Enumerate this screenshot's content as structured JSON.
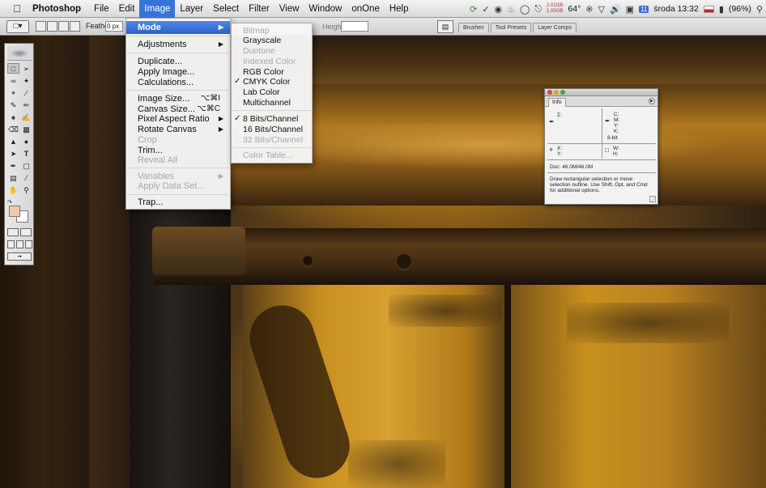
{
  "menubar": {
    "apple_icon": "apple-icon",
    "app_name": "Photoshop",
    "items": [
      "File",
      "Edit",
      "Image",
      "Layer",
      "Select",
      "Filter",
      "View",
      "Window",
      "onOne",
      "Help"
    ],
    "active_item": "Image",
    "status": {
      "memory_top": "2.01GB",
      "memory_bottom": "1.00GB",
      "temperature": "64°",
      "date_badge": "11",
      "clock": "środa 13:32",
      "battery": "(96%)"
    }
  },
  "options_bar": {
    "feather_label": "Feather:",
    "feather_value": "0 px",
    "height_label": "Height:",
    "palette_tabs": [
      "Brushes",
      "Tool Presets",
      "Layer Comps"
    ]
  },
  "image_menu": {
    "items": [
      {
        "label": "Mode",
        "highlighted": true,
        "submenu": true
      },
      {
        "label": "Adjustments",
        "submenu": true
      },
      {
        "label": "Duplicate..."
      },
      {
        "label": "Apply Image..."
      },
      {
        "label": "Calculations..."
      },
      {
        "label": "Image Size...",
        "shortcut": "⌥⌘I"
      },
      {
        "label": "Canvas Size...",
        "shortcut": "⌥⌘C"
      },
      {
        "label": "Pixel Aspect Ratio",
        "submenu": true
      },
      {
        "label": "Rotate Canvas",
        "submenu": true
      },
      {
        "label": "Crop",
        "disabled": true
      },
      {
        "label": "Trim..."
      },
      {
        "label": "Reveal All",
        "disabled": true
      },
      {
        "label": "Variables",
        "disabled": true,
        "submenu": true
      },
      {
        "label": "Apply Data Set...",
        "disabled": true
      },
      {
        "label": "Trap..."
      }
    ]
  },
  "mode_submenu": {
    "items": [
      {
        "label": "Bitmap",
        "disabled": true
      },
      {
        "label": "Grayscale"
      },
      {
        "label": "Duotone",
        "disabled": true
      },
      {
        "label": "Indexed Color",
        "disabled": true
      },
      {
        "label": "RGB Color"
      },
      {
        "label": "CMYK Color",
        "checked": true
      },
      {
        "label": "Lab Color"
      },
      {
        "label": "Multichannel"
      },
      {
        "label": "8 Bits/Channel",
        "checked": true
      },
      {
        "label": "16 Bits/Channel"
      },
      {
        "label": "32 Bits/Channel",
        "disabled": true
      },
      {
        "label": "Color Table...",
        "disabled": true
      }
    ]
  },
  "info_panel": {
    "tab": "Info",
    "sigma": "Σ:",
    "cmyk_c": "C:",
    "cmyk_m": "M:",
    "cmyk_y": "Y:",
    "cmyk_k": "K:",
    "bit_depth": "8-bit",
    "x": "X:",
    "y": "Y:",
    "w": "W:",
    "h": "H:",
    "doc": "Doc: 46.0M/46.0M",
    "hint": "Draw rectangular selection or move selection outline.  Use Shift, Opt, and Cmd for additional options."
  },
  "toolbox": {
    "foreground_color": "#f4c8a8",
    "background_color": "#ffffff"
  }
}
